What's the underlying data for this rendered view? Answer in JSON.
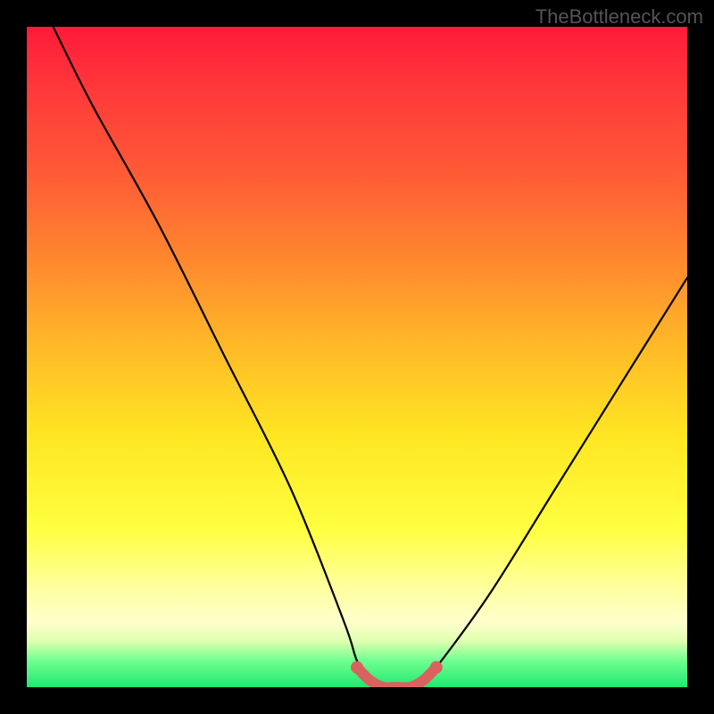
{
  "watermark": "TheBottleneck.com",
  "chart_data": {
    "type": "line",
    "title": "",
    "xlabel": "",
    "ylabel": "",
    "xlim": [
      0,
      100
    ],
    "ylim": [
      0,
      100
    ],
    "series": [
      {
        "name": "bottleneck-curve",
        "x": [
          4,
          10,
          20,
          30,
          40,
          48,
          50,
          52,
          54,
          56,
          58,
          60,
          62,
          70,
          80,
          90,
          100
        ],
        "y": [
          100,
          88,
          70,
          50,
          30,
          10,
          4,
          1,
          0,
          0,
          0,
          1,
          3,
          14,
          30,
          46,
          62
        ]
      },
      {
        "name": "optimal-marker",
        "x": [
          50,
          52,
          54,
          56,
          58,
          60,
          62
        ],
        "y": [
          3,
          1,
          0,
          0,
          0,
          1,
          3
        ]
      }
    ]
  }
}
